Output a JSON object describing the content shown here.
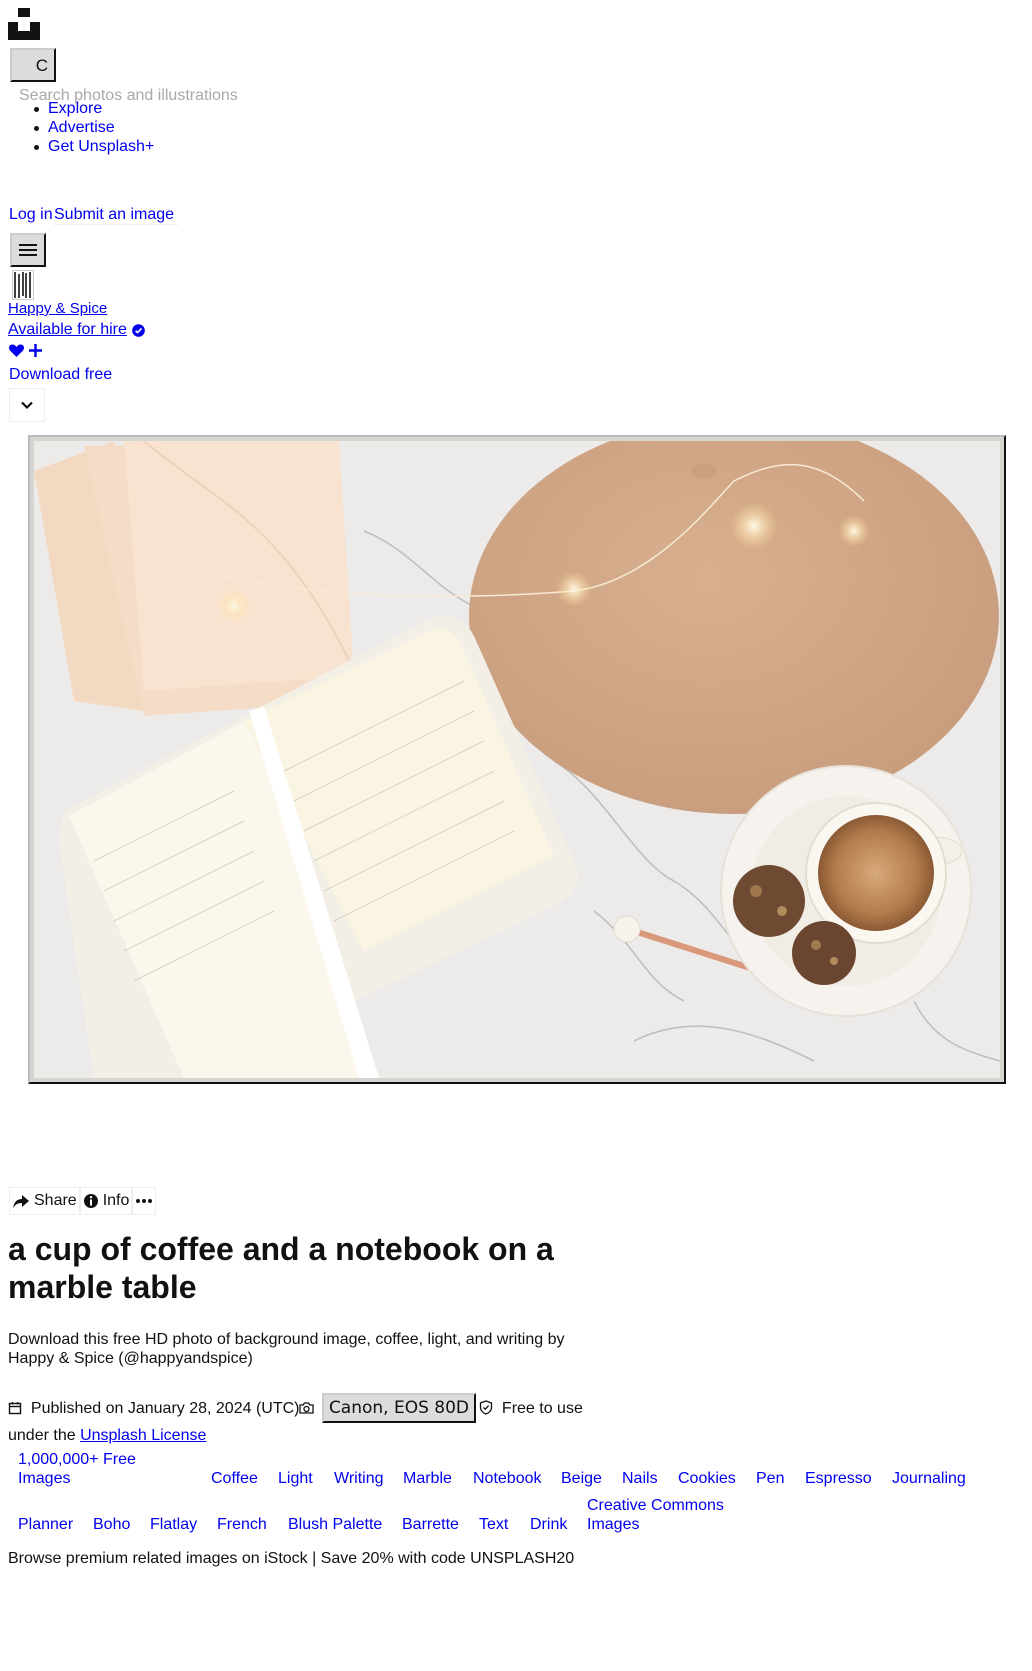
{
  "header": {
    "search_button_label": "C",
    "search_placeholder": "Search photos and illustrations",
    "nav": [
      "Explore",
      "Advertise",
      "Get Unsplash+"
    ],
    "login": "Log in",
    "submit": "Submit an image"
  },
  "author": {
    "name": "Happy & Spice",
    "hire": "Available for hire"
  },
  "download_label": "Download free",
  "actions": {
    "share": "Share",
    "info": "Info"
  },
  "photo": {
    "title": "a cup of coffee and a notebook on a marble table",
    "description": "Download this free HD photo of background image, coffee, light, and writing by Happy & Spice (@happyandspice)"
  },
  "meta": {
    "published": "Published on January 28, 2024 (UTC)",
    "camera": "Canon, EOS 80D",
    "free_to_use": "Free to use",
    "under_the": "under the",
    "license": "Unsplash License"
  },
  "tags": [
    "1,000,000+ Free",
    "Images",
    "Coffee",
    "Light",
    "Writing",
    "Marble",
    "Notebook",
    "Beige",
    "Nails",
    "Cookies",
    "Pen",
    "Espresso",
    "Journaling",
    "Planner",
    "Boho",
    "Flatlay",
    "French",
    "Blush Palette",
    "Barrette",
    "Text",
    "Drink",
    "Creative Commons",
    "Images"
  ],
  "promo": "Browse premium related images on iStock | Save 20% with code UNSPLASH20"
}
